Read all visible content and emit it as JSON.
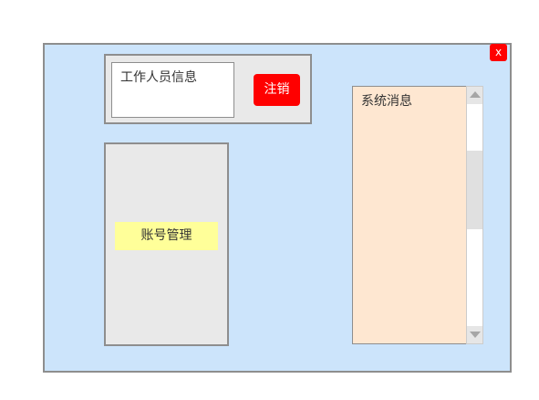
{
  "window": {
    "close_label": "x"
  },
  "staff": {
    "info_label": "工作人员信息",
    "logout_label": "注销"
  },
  "sidebar": {
    "account_label": "账号管理"
  },
  "system_messages": {
    "title": "系统消息"
  },
  "colors": {
    "window_bg": "#cce4fb",
    "danger": "#ff0000",
    "account_button": "#ffff99",
    "message_panel": "#fee7d1",
    "panel_gray": "#e9e9e9"
  }
}
